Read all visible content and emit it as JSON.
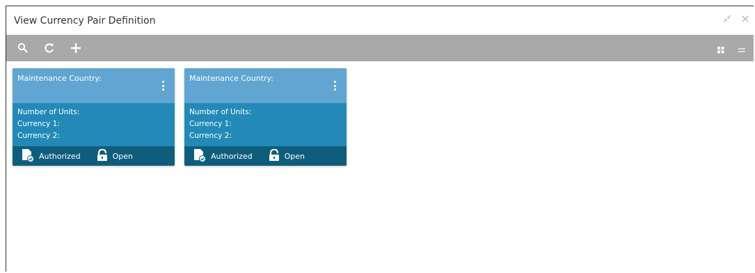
{
  "window": {
    "title": "View Currency Pair Definition",
    "controls": [
      "minimize-icon",
      "close-icon"
    ]
  },
  "toolbar": {
    "left_icons": [
      "search-icon",
      "refresh-icon",
      "add-icon"
    ],
    "right_icons": [
      "grid-view-icon",
      "list-view-icon"
    ]
  },
  "cards": [
    {
      "header_label": "Maintenance Country:",
      "fields": [
        "Number of Units:",
        "Currency 1:",
        "Currency 2:"
      ],
      "status_authorized": "Authorized",
      "status_open": "Open"
    },
    {
      "header_label": "Maintenance Country:",
      "fields": [
        "Number of Units:",
        "Currency 1:",
        "Currency 2:"
      ],
      "status_authorized": "Authorized",
      "status_open": "Open"
    }
  ],
  "colors": {
    "toolbar_bg": "#a9a9a9",
    "card_header": "#61a6d2",
    "card_body": "#238ab8",
    "card_footer": "#0f5d7d"
  }
}
